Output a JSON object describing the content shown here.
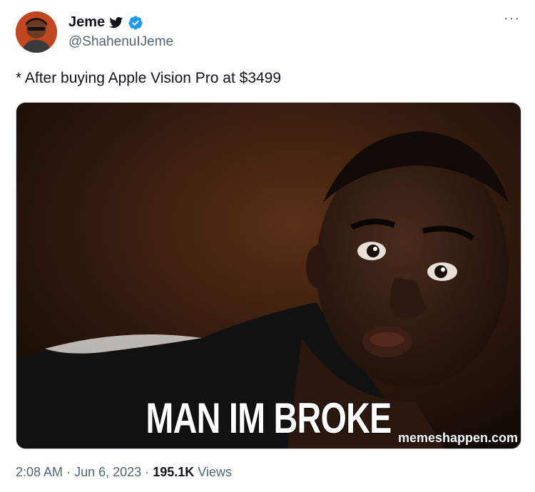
{
  "author": {
    "name": "Jeme",
    "handle": "@ShahenuIJeme",
    "badges": [
      "twitter-bird-icon",
      "verified-badge-icon"
    ]
  },
  "tweet": {
    "text": "* After buying Apple Vision Pro at $3499"
  },
  "media": {
    "caption": "MAN IM BROKE",
    "watermark": "memeshappen.com"
  },
  "meta": {
    "time": "2:08 AM",
    "separator": "·",
    "date": "Jun 6, 2023",
    "views_count": "195.1K",
    "views_label": "Views"
  },
  "colors": {
    "text": "#0f1419",
    "secondary": "#536471",
    "verified": "#1d9bf0"
  }
}
